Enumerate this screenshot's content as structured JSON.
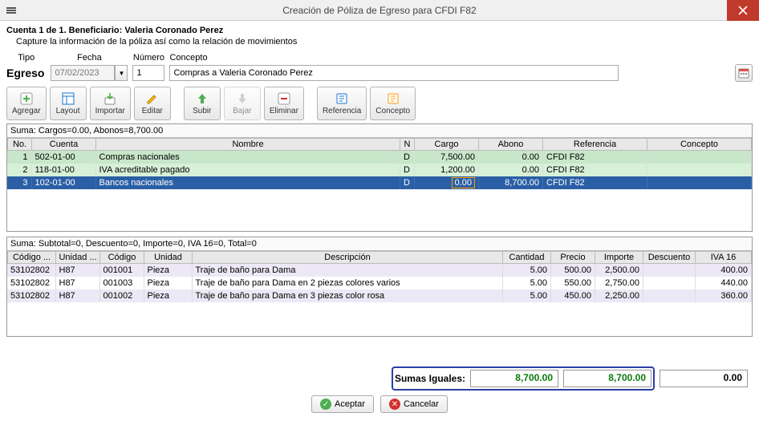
{
  "window": {
    "title": "Creación de Póliza de Egreso para CFDI F82"
  },
  "header": {
    "line1": "Cuenta 1 de 1. Beneficiario: Valeria Coronado Perez",
    "line2": "Capture la información de la póliza así como la relación de movimientos"
  },
  "form": {
    "tipo_label": "Tipo",
    "tipo_value": "Egreso",
    "fecha_label": "Fecha",
    "fecha_value": "07/02/2023",
    "numero_label": "Número",
    "numero_value": "1",
    "concepto_label": "Concepto",
    "concepto_value": "Compras a Valeria Coronado Perez"
  },
  "toolbar": {
    "agregar": "Agregar",
    "layout": "Layout",
    "importar": "Importar",
    "editar": "Editar",
    "subir": "Subir",
    "bajar": "Bajar",
    "eliminar": "Eliminar",
    "referencia": "Referencia",
    "concepto": "Concepto"
  },
  "grid1": {
    "summary": "Suma:  Cargos=0.00, Abonos=8,700.00",
    "cols": {
      "no": "No.",
      "cuenta": "Cuenta",
      "nombre": "Nombre",
      "n": "N",
      "cargo": "Cargo",
      "abono": "Abono",
      "referencia": "Referencia",
      "concepto": "Concepto"
    },
    "rows": [
      {
        "no": "1",
        "cuenta": "502-01-00",
        "nombre": "Compras nacionales",
        "n": "D",
        "cargo": "7,500.00",
        "abono": "0.00",
        "referencia": "CFDI F82",
        "concepto": ""
      },
      {
        "no": "2",
        "cuenta": "118-01-00",
        "nombre": "IVA acreditable pagado",
        "n": "D",
        "cargo": "1,200.00",
        "abono": "0.00",
        "referencia": "CFDI F82",
        "concepto": ""
      },
      {
        "no": "3",
        "cuenta": "102-01-00",
        "nombre": "Bancos nacionales",
        "n": "D",
        "cargo": "0.00",
        "abono": "8,700.00",
        "referencia": "CFDI F82",
        "concepto": ""
      }
    ]
  },
  "grid2": {
    "summary": "Suma:  Subtotal=0, Descuento=0, Importe=0, IVA 16=0, Total=0",
    "cols": {
      "codigoA": "Código ...",
      "unidadA": "Unidad ...",
      "codigo": "Código",
      "unidad": "Unidad",
      "descripcion": "Descripción",
      "cantidad": "Cantidad",
      "precio": "Precio",
      "importe": "Importe",
      "descuento": "Descuento",
      "iva16": "IVA 16"
    },
    "rows": [
      {
        "codigoA": "53102802",
        "unidadA": "H87",
        "codigo": "001001",
        "unidad": "Pieza",
        "descripcion": "Traje de baño para Dama",
        "cantidad": "5.00",
        "precio": "500.00",
        "importe": "2,500.00",
        "descuento": "",
        "iva16": "400.00"
      },
      {
        "codigoA": "53102802",
        "unidadA": "H87",
        "codigo": "001003",
        "unidad": "Pieza",
        "descripcion": "Traje de baño para Dama en 2 piezas colores varios",
        "cantidad": "5.00",
        "precio": "550.00",
        "importe": "2,750.00",
        "descuento": "",
        "iva16": "440.00"
      },
      {
        "codigoA": "53102802",
        "unidadA": "H87",
        "codigo": "001002",
        "unidad": "Pieza",
        "descripcion": "Traje de baño para Dama en 3 piezas color rosa",
        "cantidad": "5.00",
        "precio": "450.00",
        "importe": "2,250.00",
        "descuento": "",
        "iva16": "360.00"
      }
    ]
  },
  "totals": {
    "label": "Sumas Iguales:",
    "cargos": "8,700.00",
    "abonos": "8,700.00",
    "diff": "0.00"
  },
  "buttons": {
    "aceptar": "Aceptar",
    "cancelar": "Cancelar"
  }
}
